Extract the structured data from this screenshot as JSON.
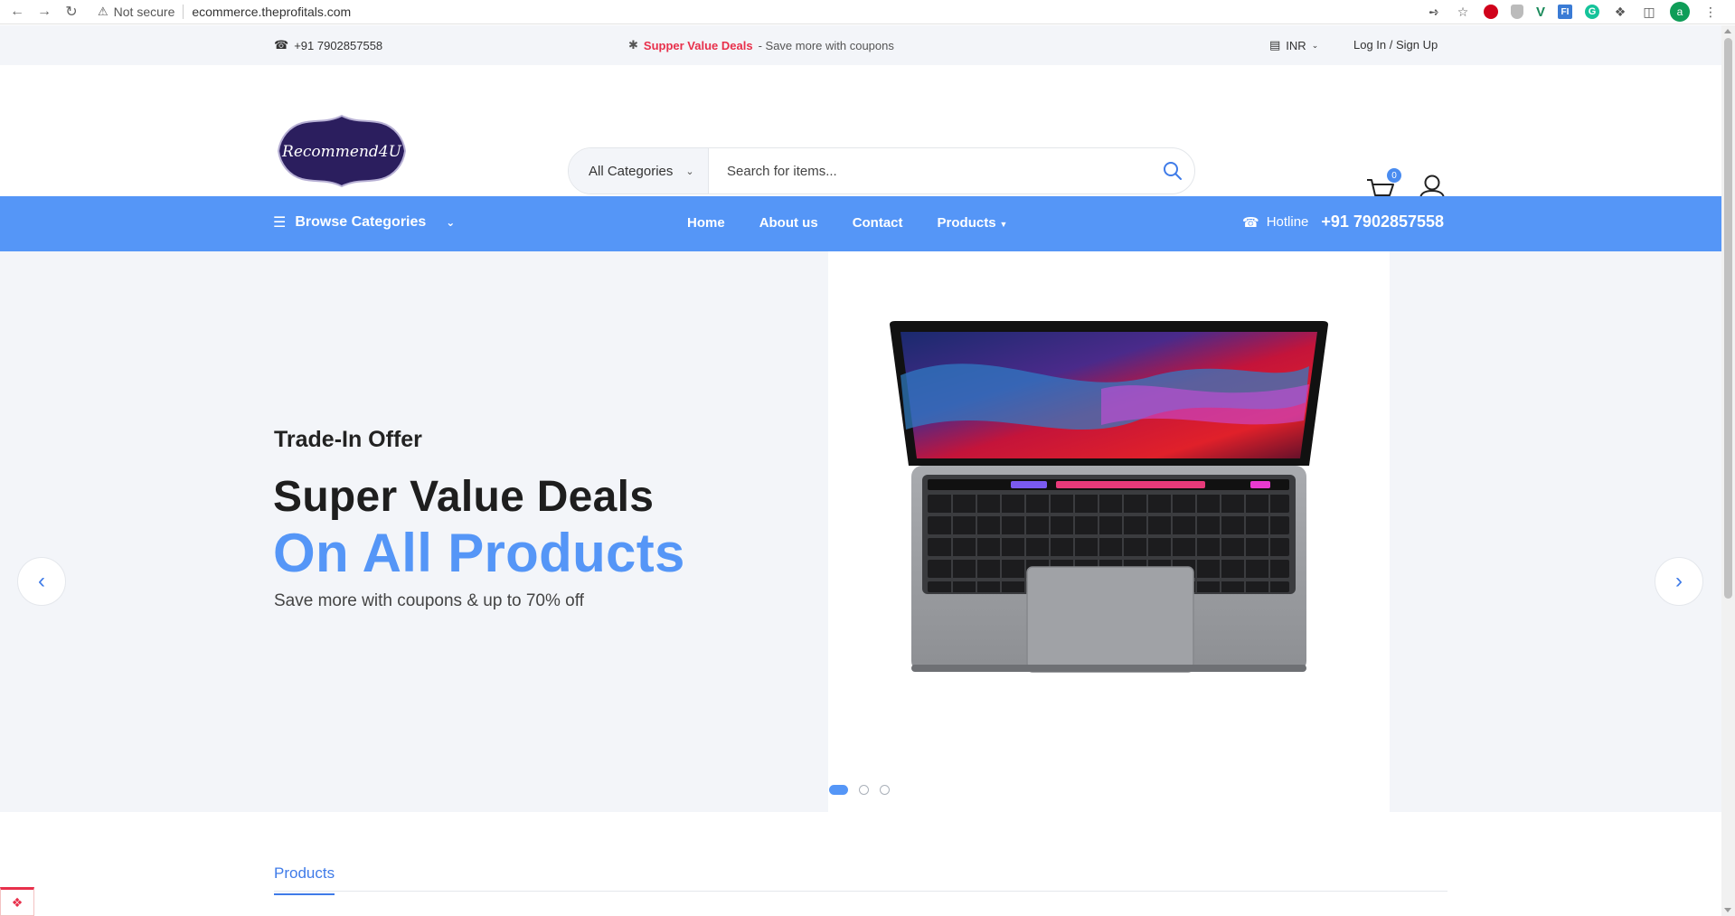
{
  "browser": {
    "security_label": "Not secure",
    "url": "ecommerce.theprofitals.com",
    "profile_initial": "a"
  },
  "topbar": {
    "phone": "+91 7902857558",
    "promo_highlight": "Supper Value Deals",
    "promo_rest": "- Save more with coupons",
    "currency": "INR",
    "auth_link": "Log In / Sign Up"
  },
  "header": {
    "logo_text": "Recommend4U",
    "search": {
      "category": "All Categories",
      "placeholder": "Search for items..."
    },
    "cart_count": "0"
  },
  "nav": {
    "browse_label": "Browse Categories",
    "items": [
      {
        "label": "Home"
      },
      {
        "label": "About us"
      },
      {
        "label": "Contact"
      },
      {
        "label": "Products"
      }
    ],
    "hotline_label": "Hotline",
    "hotline_number": "+91 7902857558"
  },
  "hero": {
    "subtitle": "Trade-In Offer",
    "title_line1": "Super Value Deals",
    "title_line2": "On All Products",
    "description": "Save more with coupons & up to 70% off",
    "slide_count": 3,
    "active_slide": 1
  },
  "products": {
    "tab_label": "Products"
  },
  "colors": {
    "primary": "#5596f7",
    "accent_red": "#e8304b",
    "hero_bg": "#f3f5f9",
    "logo_bg": "#2b1e5e"
  }
}
